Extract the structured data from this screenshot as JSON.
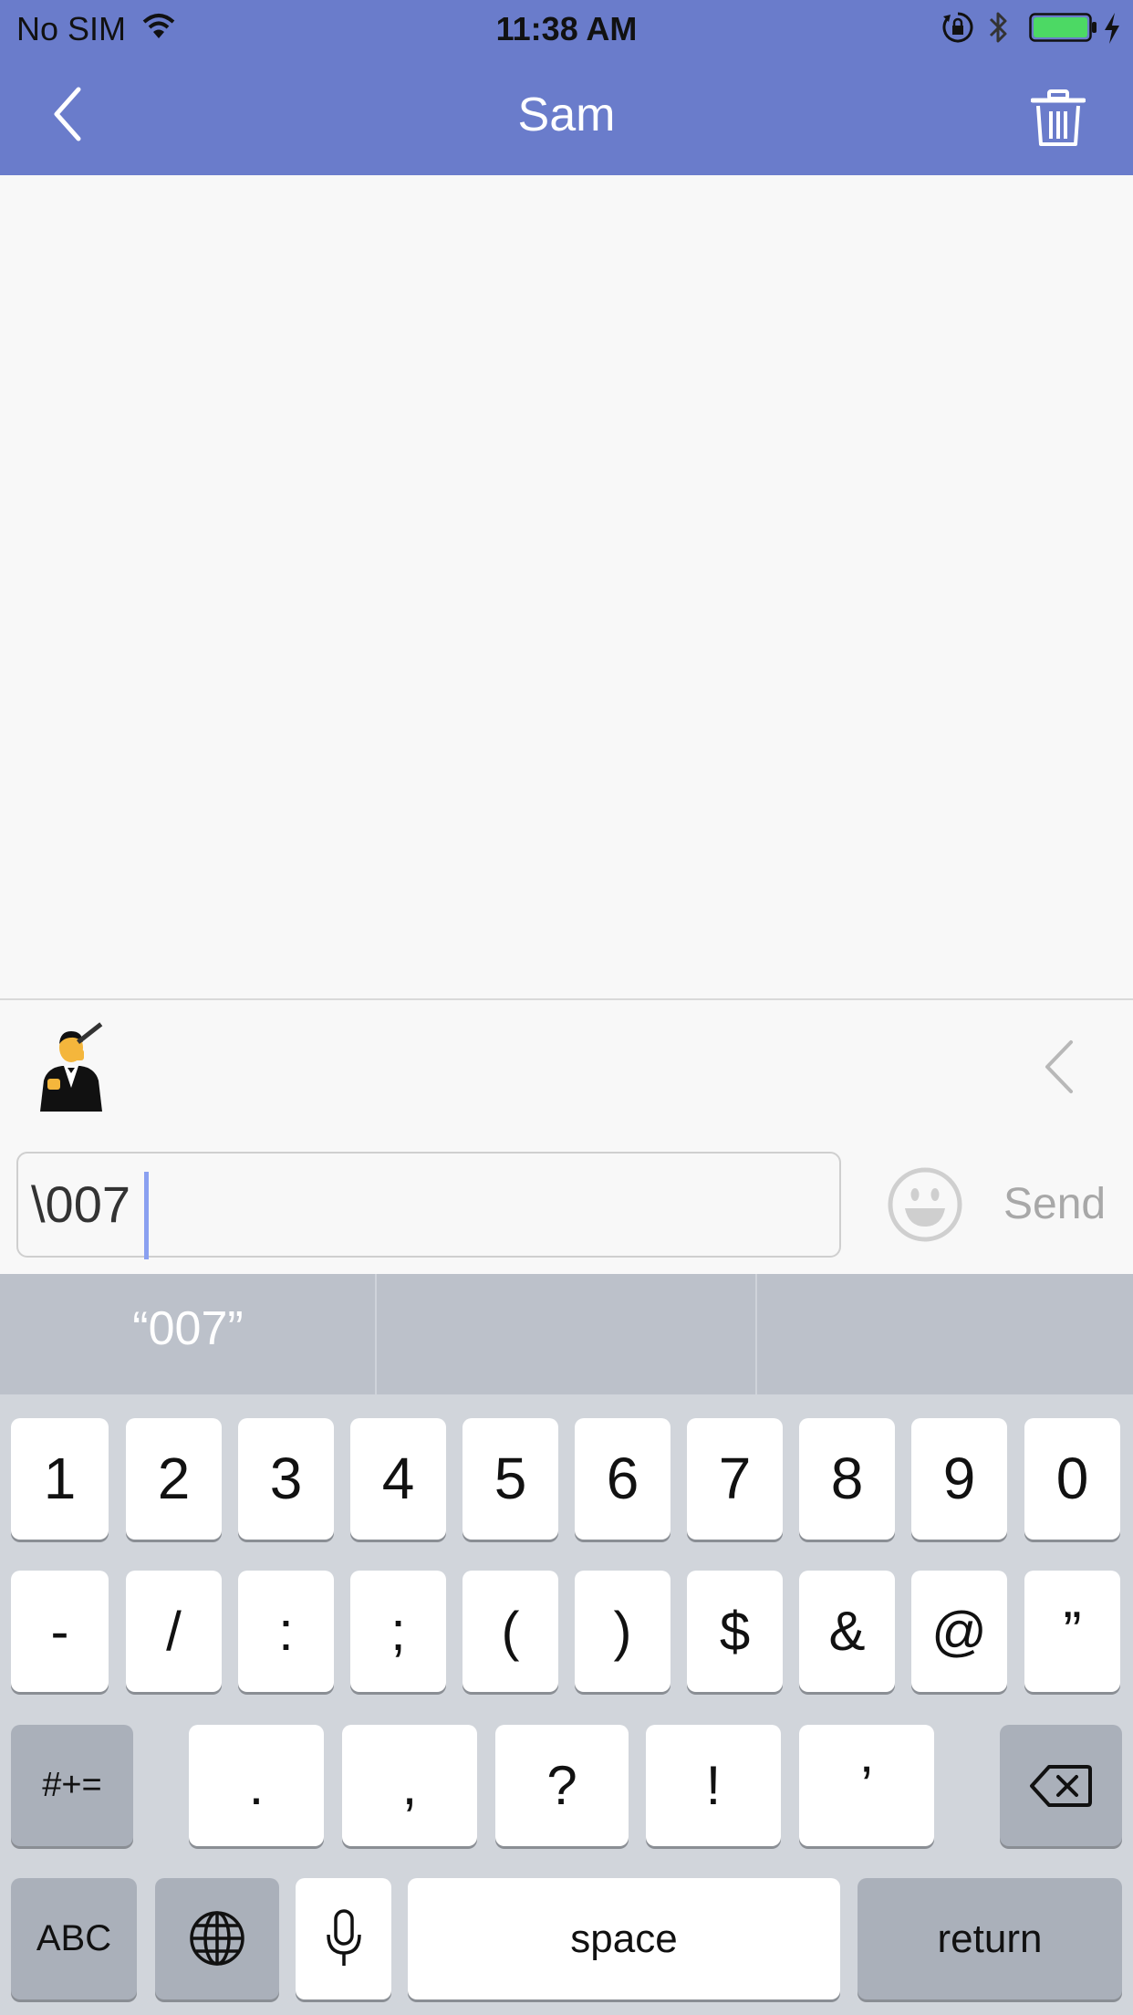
{
  "status_bar": {
    "carrier": "No SIM",
    "time": "11:38 AM"
  },
  "header": {
    "title": "Sam",
    "background_color": "#6a7ccb"
  },
  "sticker_strip": {
    "sticker": "007 sticker"
  },
  "composer": {
    "input_value": "\\007",
    "send_label": "Send"
  },
  "keyboard": {
    "suggestions": [
      "“007”",
      "",
      ""
    ],
    "row1": [
      "1",
      "2",
      "3",
      "4",
      "5",
      "6",
      "7",
      "8",
      "9",
      "0"
    ],
    "row2": [
      "-",
      "/",
      ":",
      ";",
      "(",
      ")",
      "$",
      "&",
      "@",
      "”"
    ],
    "row3": [
      ".",
      ",",
      "?",
      "!",
      "’"
    ],
    "symbols_toggle": "#+=",
    "abc_key": "ABC",
    "space_key": "space",
    "return_key": "return"
  }
}
